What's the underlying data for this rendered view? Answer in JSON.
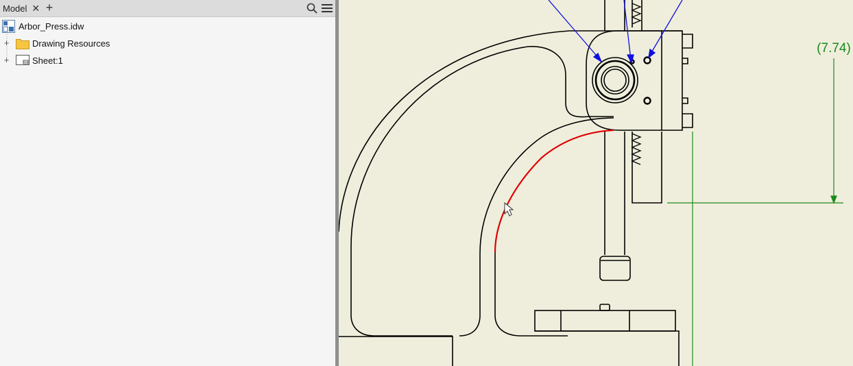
{
  "browser": {
    "tab_label": "Model",
    "close_glyph": "✕",
    "add_glyph": "+",
    "search_icon": "search-icon",
    "menu_icon": "hamburger-menu-icon",
    "tree": [
      {
        "label": "Arbor_Press.idw",
        "icon": "drawing-file-icon",
        "expandable": false
      },
      {
        "label": "Drawing Resources",
        "icon": "folder-icon",
        "expandable": true
      },
      {
        "label": "Sheet:1",
        "icon": "sheet-icon",
        "expandable": true
      }
    ]
  },
  "drawing": {
    "dimension_text": "(7.74)",
    "colors": {
      "background": "#efeedc",
      "geometry": "#000000",
      "selected": "#e00000",
      "leaders": "#1010e0",
      "dimension": "#1a8a1a"
    }
  }
}
